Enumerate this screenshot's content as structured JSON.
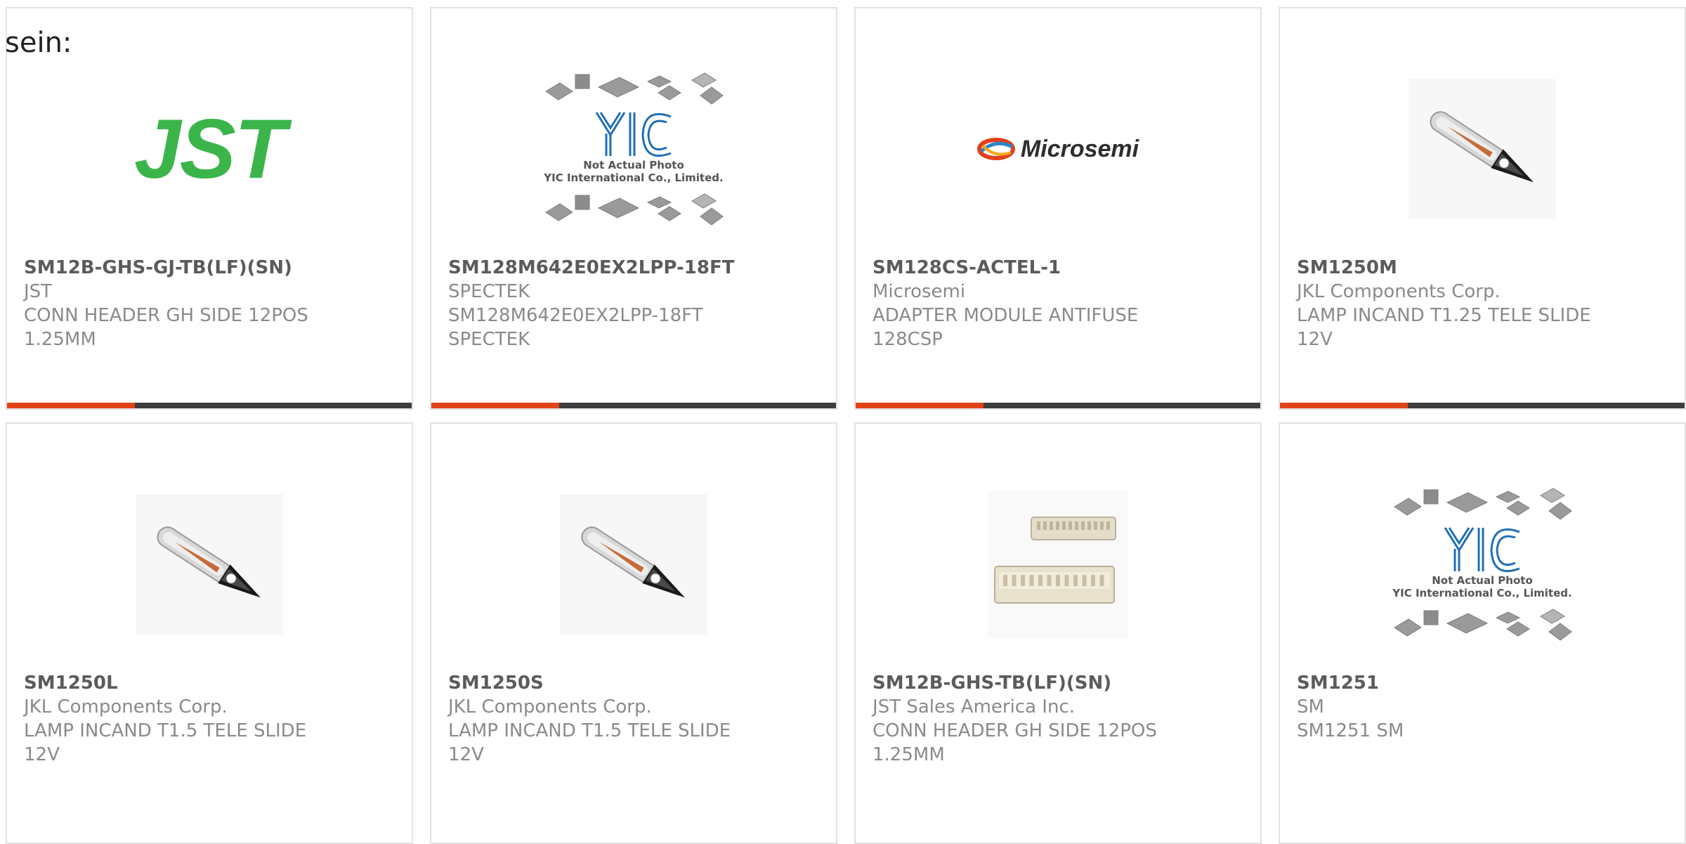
{
  "page": {
    "intro_text": "sein:"
  },
  "colors": {
    "accent": "#e14418",
    "bar": "#3d3d3d",
    "jst_green": "#3bb54a",
    "yic_blue": "#1f6fb5"
  },
  "products": [
    {
      "part_number": "SM12B-GHS-GJ-TB(LF)(SN)",
      "manufacturer": "JST",
      "desc1": "CONN HEADER GH SIDE 12POS",
      "desc2": "1.25MM",
      "image": {
        "type": "jst-logo",
        "logo_text": "JST"
      }
    },
    {
      "part_number": "SM128M642E0EX2LPP-18FT",
      "manufacturer": "SPECTEK",
      "desc1": "SM128M642E0EX2LPP-18FT",
      "desc2": "SPECTEK",
      "image": {
        "type": "yic-placeholder",
        "logo_text": "YIC",
        "caption1": "Not Actual Photo",
        "caption2": "YIC International Co., Limited."
      }
    },
    {
      "part_number": "SM128CS-ACTEL-1",
      "manufacturer": "Microsemi",
      "desc1": "ADAPTER MODULE ANTIFUSE",
      "desc2": "128CSP",
      "image": {
        "type": "microsemi-logo",
        "logo_text": "Microsemi"
      }
    },
    {
      "part_number": "SM1250M",
      "manufacturer": "JKL Components Corp.",
      "desc1": "LAMP INCAND T1.25 TELE SLIDE",
      "desc2": "12V",
      "image": {
        "type": "lamp-photo"
      }
    },
    {
      "part_number": "SM1250L",
      "manufacturer": "JKL Components Corp.",
      "desc1": "LAMP INCAND T1.5 TELE SLIDE",
      "desc2": "12V",
      "image": {
        "type": "lamp-photo"
      }
    },
    {
      "part_number": "SM1250S",
      "manufacturer": "JKL Components Corp.",
      "desc1": "LAMP INCAND T1.5 TELE SLIDE",
      "desc2": "12V",
      "image": {
        "type": "lamp-photo"
      }
    },
    {
      "part_number": "SM12B-GHS-TB(LF)(SN)",
      "manufacturer": "JST Sales America Inc.",
      "desc1": "CONN HEADER GH SIDE 12POS",
      "desc2": "1.25MM",
      "image": {
        "type": "connector-photo"
      }
    },
    {
      "part_number": "SM1251",
      "manufacturer": "SM",
      "desc1": "SM1251 SM",
      "desc2": "",
      "image": {
        "type": "yic-placeholder",
        "logo_text": "YIC",
        "caption1": "Not Actual Photo",
        "caption2": "YIC International Co., Limited."
      }
    }
  ]
}
